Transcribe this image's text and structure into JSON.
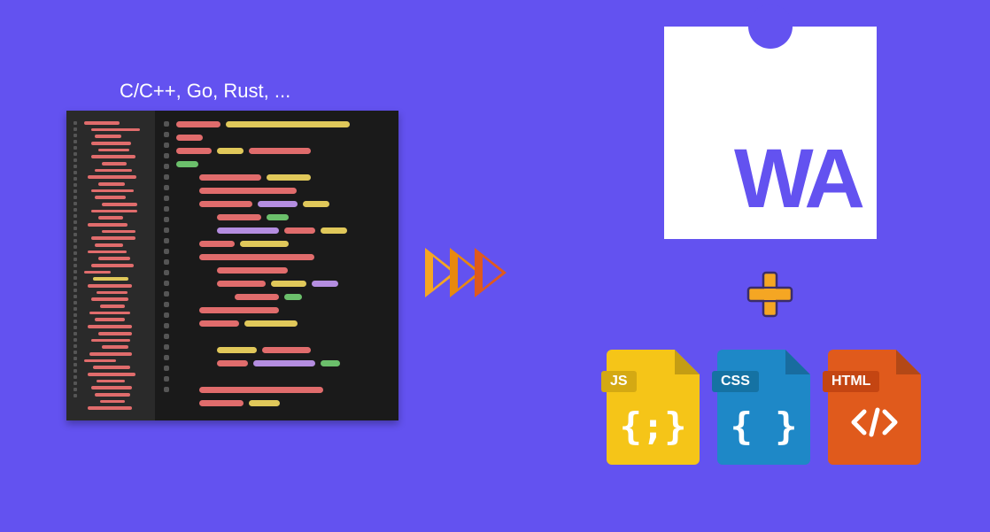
{
  "source_label": "C/C++, Go, Rust, ...",
  "wa_logo_text": "WA",
  "files": {
    "js": {
      "label": "JS",
      "symbol": "{;}"
    },
    "css": {
      "label": "CSS",
      "symbol": "{ }"
    },
    "html": {
      "label": "HTML",
      "symbol": "</>"
    }
  },
  "colors": {
    "background": "#6352f0",
    "wa_purple": "#6352f0",
    "js_yellow": "#f5c518",
    "css_blue": "#1e88c7",
    "html_orange": "#e05a1c"
  }
}
